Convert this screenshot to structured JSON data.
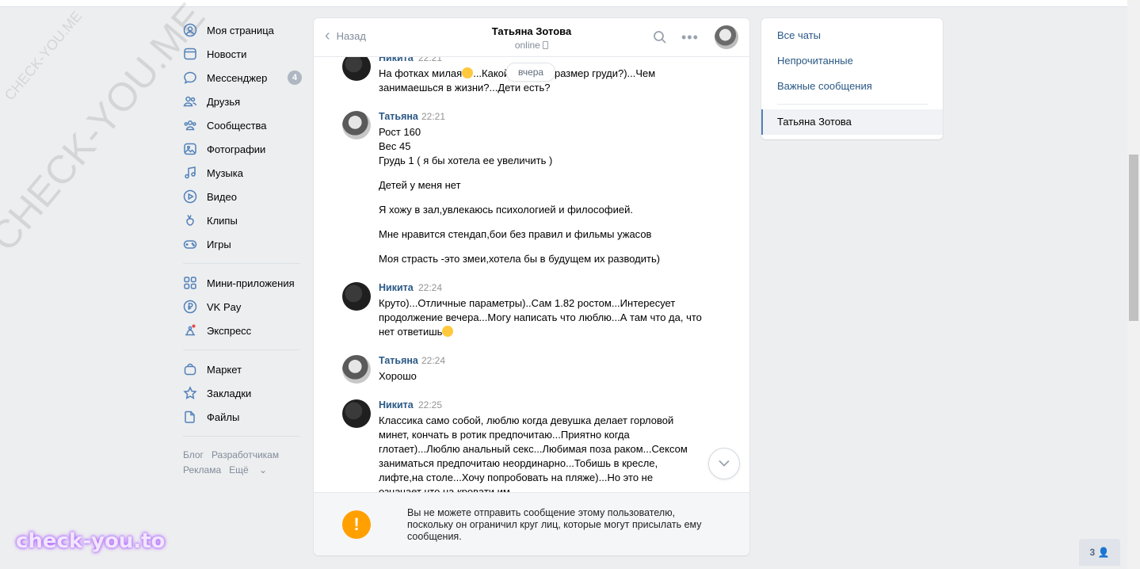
{
  "watermark": {
    "diagonal_large": "CHECK-YOU.ME",
    "diagonal_small": "CHECK-YOU.ME",
    "bottom": "check-you.to"
  },
  "sidebar": {
    "items": [
      {
        "label": "Моя страница",
        "icon": "user-circle-icon"
      },
      {
        "label": "Новости",
        "icon": "newspaper-icon"
      },
      {
        "label": "Мессенджер",
        "icon": "chat-bubble-icon",
        "badge": "4"
      },
      {
        "label": "Друзья",
        "icon": "friends-icon"
      },
      {
        "label": "Сообщества",
        "icon": "communities-icon"
      },
      {
        "label": "Фотографии",
        "icon": "photo-icon"
      },
      {
        "label": "Музыка",
        "icon": "music-note-icon"
      },
      {
        "label": "Видео",
        "icon": "play-circle-icon"
      },
      {
        "label": "Клипы",
        "icon": "clips-icon"
      },
      {
        "label": "Игры",
        "icon": "gamepad-icon"
      }
    ],
    "items2": [
      {
        "label": "Мини-приложения",
        "icon": "grid-apps-icon"
      },
      {
        "label": "VK Pay",
        "icon": "ruble-coin-icon"
      },
      {
        "label": "Экспресс",
        "icon": "express-icon"
      }
    ],
    "items3": [
      {
        "label": "Маркет",
        "icon": "bag-icon"
      },
      {
        "label": "Закладки",
        "icon": "star-icon"
      },
      {
        "label": "Файлы",
        "icon": "file-icon"
      }
    ],
    "footer": {
      "blog": "Блог",
      "developers": "Разработчикам",
      "ads": "Реклама",
      "more": "Ещё"
    }
  },
  "chat": {
    "back_label": "Назад",
    "title": "Татьяна Зотова",
    "status": "online",
    "date_pill": "вчера",
    "messages": [
      {
        "author": "Никита",
        "time": "22:21",
        "lines": [
          "На фотках милая",
          "...Какой рост,вес,размер груди?)...Чем занимаешься в жизни?...Дети есть?"
        ]
      },
      {
        "author": "Татьяна",
        "time": "22:21",
        "lines": [
          "Рост 160",
          "Вес 45",
          "Грудь 1 ( я бы хотела ее увеличить )",
          "Детей у меня нет",
          "Я хожу в зал,увлекаюсь психологией и философией.",
          "Мне нравится стендап,бои без правил и фильмы ужасов",
          "Моя страсть -это змеи,хотела бы в будущем их разводить)"
        ]
      },
      {
        "author": "Никита",
        "time": "22:24",
        "lines": [
          "Круто)...Отличные параметры)..Сам 1.82 ростом...Интересует продолжение вечера...Могу написать что люблю...А там что да, что нет ответишь"
        ]
      },
      {
        "author": "Татьяна",
        "time": "22:24",
        "lines": [
          "Хорошо"
        ]
      },
      {
        "author": "Никита",
        "time": "22:25",
        "lines": [
          "Классика само собой, люблю когда девушка делает горловой минет, кончать в ротик предпочитаю...Приятно когда глотает)...Люблю анальный секс...Любимая поза раком...Сексом заниматься предпочитаю неординарно...Тобишь в кресле, лифте,на столе...Хочу попробовать на пляже)...Но это не означает что на кровати им"
        ]
      }
    ],
    "notice": "Вы не можете отправить сообщение этому пользователю, поскольку он ограничил круг лиц, которые могут присылать ему сообщения."
  },
  "right_panel": {
    "items": [
      "Все чаты",
      "Непрочитанные",
      "Важные сообщения"
    ],
    "active": "Татьяна Зотова"
  },
  "corner_button": {
    "count": "3"
  },
  "colors": {
    "link": "#2a5885",
    "accent": "#5181b8",
    "warning": "#ffa000",
    "background": "#edeef0"
  }
}
